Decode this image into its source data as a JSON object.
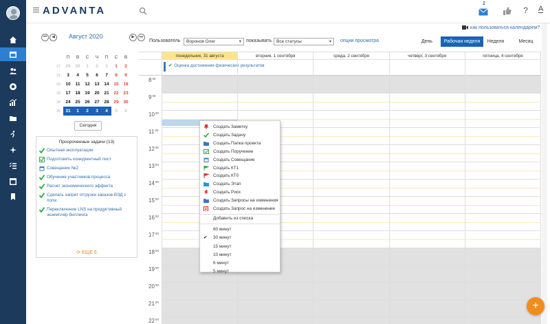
{
  "app": {
    "logo": "ADVANTA",
    "mail_count": "2",
    "help_glyph": "?",
    "font_glyph": "A"
  },
  "nav": {
    "items": [
      "home-icon",
      "calendar-icon",
      "people-icon",
      "lifebuoy-icon",
      "chart-icon",
      "folder-icon",
      "runner-icon",
      "sparkle-icon",
      "checklist-icon",
      "window-icon",
      "bookmark-icon"
    ],
    "active_index": 1
  },
  "calendar_nav": {
    "prev_year": "⏮",
    "prev": "◀",
    "month": "Август 2020",
    "next": "▶",
    "next_year": "⏭"
  },
  "mini_calendar": {
    "headers": [
      "П",
      "В",
      "С",
      "Ч",
      "П",
      "С",
      "В"
    ],
    "weeks": [
      {
        "wk": "27",
        "days": [
          {
            "d": "29",
            "c": "other"
          },
          {
            "d": "30",
            "c": "other"
          },
          {
            "d": "1",
            "c": "other"
          },
          {
            "d": "2",
            "c": "other"
          },
          {
            "d": "3",
            "c": "other"
          },
          {
            "d": "1",
            "c": "wkend"
          },
          {
            "d": "2",
            "c": "wkend"
          }
        ]
      },
      {
        "wk": "31",
        "days": [
          {
            "d": "3",
            "c": ""
          },
          {
            "d": "4",
            "c": ""
          },
          {
            "d": "5",
            "c": ""
          },
          {
            "d": "6",
            "c": ""
          },
          {
            "d": "7",
            "c": ""
          },
          {
            "d": "8",
            "c": "wkend"
          },
          {
            "d": "9",
            "c": "wkend"
          }
        ]
      },
      {
        "wk": "32",
        "days": [
          {
            "d": "10",
            "c": ""
          },
          {
            "d": "11",
            "c": ""
          },
          {
            "d": "12",
            "c": ""
          },
          {
            "d": "13",
            "c": ""
          },
          {
            "d": "14",
            "c": ""
          },
          {
            "d": "15",
            "c": "wkend"
          },
          {
            "d": "16",
            "c": "wkend"
          }
        ]
      },
      {
        "wk": "33",
        "days": [
          {
            "d": "17",
            "c": ""
          },
          {
            "d": "18",
            "c": ""
          },
          {
            "d": "19",
            "c": ""
          },
          {
            "d": "20",
            "c": ""
          },
          {
            "d": "21",
            "c": ""
          },
          {
            "d": "22",
            "c": "wkend"
          },
          {
            "d": "23",
            "c": "wkend"
          }
        ]
      },
      {
        "wk": "34",
        "days": [
          {
            "d": "24",
            "c": ""
          },
          {
            "d": "25",
            "c": ""
          },
          {
            "d": "26",
            "c": ""
          },
          {
            "d": "27",
            "c": ""
          },
          {
            "d": "28",
            "c": ""
          },
          {
            "d": "29",
            "c": "wkend"
          },
          {
            "d": "30",
            "c": "wkend"
          }
        ]
      },
      {
        "wk": "35",
        "days": [
          {
            "d": "31",
            "c": "sel"
          },
          {
            "d": "1",
            "c": "sel"
          },
          {
            "d": "2",
            "c": "sel"
          },
          {
            "d": "3",
            "c": "sel"
          },
          {
            "d": "4",
            "c": "sel"
          },
          {
            "d": "5",
            "c": "other"
          },
          {
            "d": "6",
            "c": "other"
          }
        ]
      }
    ],
    "today_button": "Сегодня"
  },
  "overdue": {
    "title": "Просроченные задачи (13)",
    "tasks": [
      {
        "icon": "green-check-icon",
        "text": "Опытная эксплуатация"
      },
      {
        "icon": "task-checkbox-icon",
        "text": "Подготовить конкурентный лист"
      },
      {
        "icon": "meeting-icon",
        "text": "Совещание №2"
      },
      {
        "icon": "green-check-icon",
        "text": "Обучение участников процесса"
      },
      {
        "icon": "green-check-icon",
        "text": "Расчет экономического эффекта"
      },
      {
        "icon": "green-check-icon",
        "text": "Сделать запрет отгрузки заказов ВЭД с пола"
      },
      {
        "icon": "green-check-icon",
        "text": "Переключение LNS на продуктивный экземпляр биллинга"
      }
    ],
    "more": "ЕЩЕ 6"
  },
  "toolbar": {
    "help_link": "как пользоваться календарем?",
    "user_label": "Пользователь",
    "user_value": "Воронов Олег",
    "show_label": "показывать",
    "show_value": "Все статусы",
    "options_link": "опции просмотра",
    "views": [
      "День",
      "Рабочая неделя",
      "Неделя",
      "Месяц"
    ],
    "active_view": "Рабочая неделя"
  },
  "week": {
    "days": [
      "понедельник, 31 августа",
      "вторник, 1 сентября",
      "среда, 2 сентября",
      "четверг, 3 сентября",
      "пятница, 4 сентября"
    ],
    "today_index": 0,
    "allday_event": "Оценка достижения физических результатов",
    "hours": [
      "8",
      "9",
      "10",
      "11",
      "12",
      "13",
      "14",
      "15",
      "16",
      "17",
      "18",
      "19",
      "20",
      "21",
      "22"
    ],
    "minutes": "00",
    "working_hours": [
      "9",
      "10",
      "11",
      "12",
      "13",
      "14",
      "15",
      "16",
      "17"
    ]
  },
  "context_menu": {
    "create_items": [
      {
        "icon": "pin-icon",
        "color": "#d62b2b",
        "label": "Создать Заметку"
      },
      {
        "icon": "check-icon",
        "color": "#2ea84a",
        "label": "Создать Задачу"
      },
      {
        "icon": "folder-icon",
        "color": "#3a78c3",
        "label": "Создать Папка проекта"
      },
      {
        "icon": "assignment-icon",
        "color": "#2ea84a",
        "label": "Создать Поручение"
      },
      {
        "icon": "meeting-icon",
        "color": "#3a78c3",
        "label": "Создать Совещание"
      },
      {
        "icon": "flag-icon",
        "color": "#2ea84a",
        "label": "Создать КТ1"
      },
      {
        "icon": "flag-icon",
        "color": "#d62b2b",
        "label": "Создать КТ0"
      },
      {
        "icon": "folder-icon",
        "color": "#1e9be0",
        "label": "Создать Этап"
      },
      {
        "icon": "lightning-icon",
        "color": "#d62b2b",
        "label": "Создать Риск"
      },
      {
        "icon": "folder-icon",
        "color": "#3a78c3",
        "label": "Создать Запросы на изменения"
      },
      {
        "icon": "document-icon",
        "color": "#d62b2b",
        "label": "Создать Запрос на изменение"
      }
    ],
    "add_from_list": "Добавить из списка",
    "durations": [
      "60 минут",
      "30 минут",
      "15 минут",
      "10 минут",
      "6 минут",
      "5 минут"
    ],
    "selected_duration": "30 минут"
  },
  "fab": {
    "label": "+"
  },
  "colors": {
    "nav_bg": "#1b3a5c",
    "accent": "#1a63b5",
    "today": "#ffe58a",
    "fab": "#f28c1c"
  }
}
